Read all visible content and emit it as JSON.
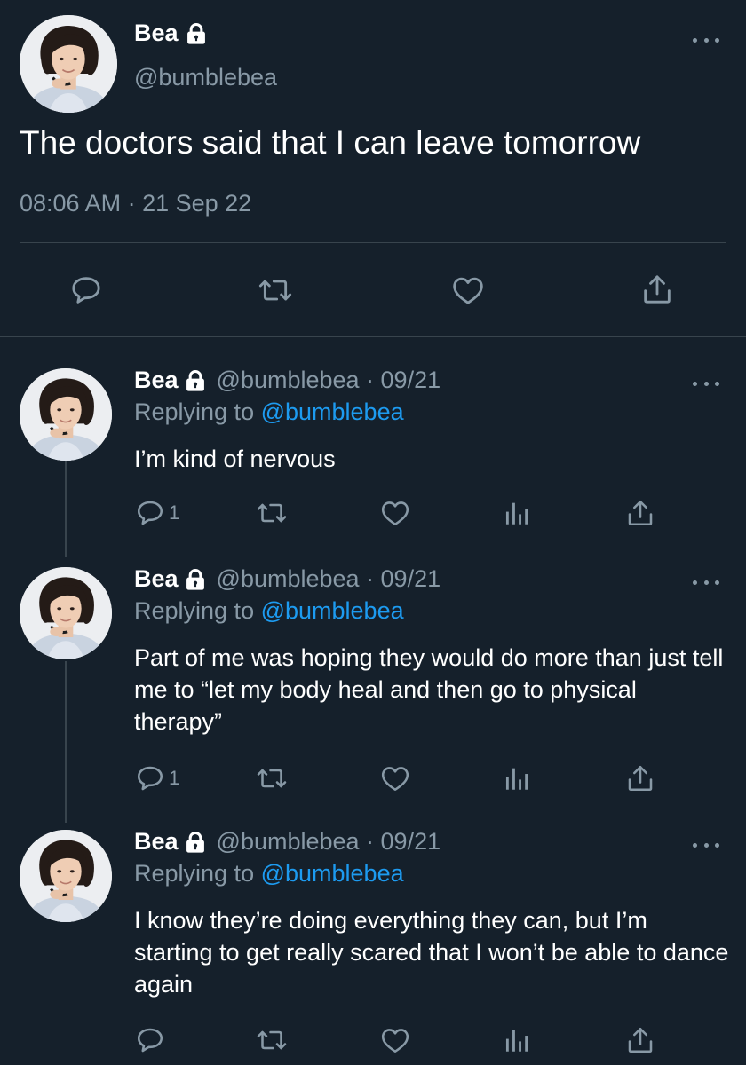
{
  "main_tweet": {
    "author_name": "Bea",
    "handle": "@bumblebea",
    "text": "The doctors said that I can leave tomorrow",
    "timestamp": "08:06 AM · 21 Sep 22",
    "icons": [
      "lock-icon",
      "more-icon",
      "reply-icon",
      "retweet-icon",
      "like-icon",
      "share-icon"
    ]
  },
  "replies": [
    {
      "author_name": "Bea",
      "handle_date": "@bumblebea · 09/21",
      "replying_prefix": "Replying to ",
      "replying_to": "@bumblebea",
      "text": "I’m kind of nervous",
      "reply_count": "1"
    },
    {
      "author_name": "Bea",
      "handle_date": "@bumblebea · 09/21",
      "replying_prefix": "Replying to ",
      "replying_to": "@bumblebea",
      "text": "Part of me was hoping they would do more than just tell me to “let my body heal and then go to physical therapy”",
      "reply_count": "1"
    },
    {
      "author_name": "Bea",
      "handle_date": "@bumblebea · 09/21",
      "replying_prefix": "Replying to ",
      "replying_to": "@bumblebea",
      "text": "I know they’re doing everything they can, but I’m starting to get really scared that I won’t be able to dance again",
      "reply_count": ""
    }
  ],
  "colors": {
    "background": "#15202b",
    "text": "#ffffff",
    "muted": "#8899a6",
    "link": "#1d9bf0",
    "divider": "#38444d"
  }
}
